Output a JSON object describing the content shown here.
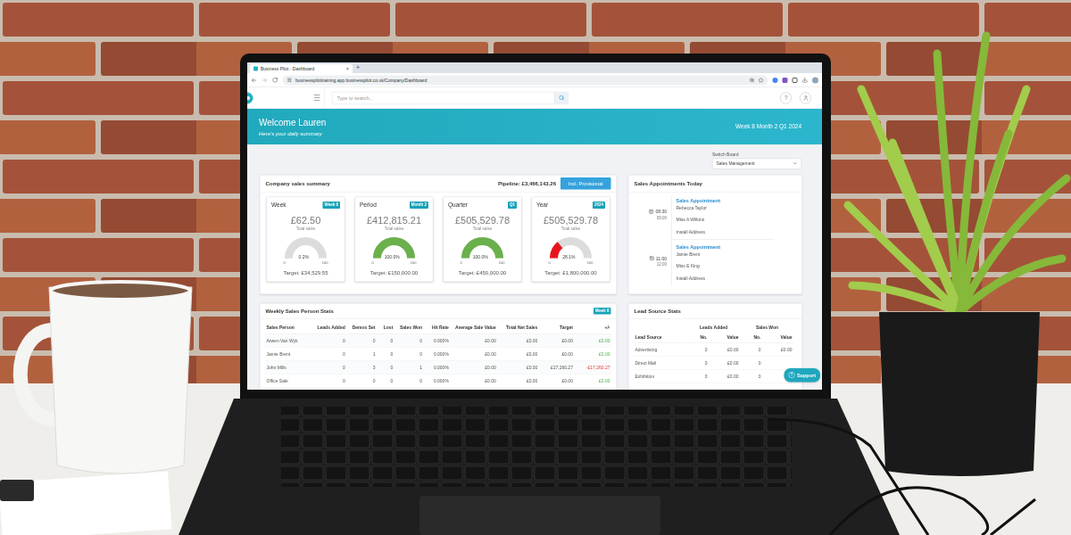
{
  "browser": {
    "tab_title": "Business Pilot - Dashboard",
    "close": "×",
    "new_tab": "+",
    "url": "businesspilottraining.app.businesspilot.co.uk/Company/Dashboard"
  },
  "app_header": {
    "menu": "☰",
    "search_placeholder": "Type to search...",
    "help": "?"
  },
  "banner": {
    "title": "Welcome Lauren",
    "subtitle": "Here's your daily summary",
    "period": "Week 8 Month 2 Q1 2024"
  },
  "switch_board": {
    "label": "Switch Board",
    "value": "Sales Management"
  },
  "sales_summary": {
    "title": "Company sales summary",
    "pipeline": "Pipeline: £3,466,143.26",
    "toggle": "Incl. Provisional",
    "cards": [
      {
        "title": "Week",
        "badge": "Week 8",
        "value": "£62.50",
        "caption": "Total sales",
        "level": 0.002,
        "percent": "0.2%",
        "min": "0",
        "max": "100",
        "target": "Target: £34,529.55",
        "color": "#6ab04c"
      },
      {
        "title": "Period",
        "badge": "Month 2",
        "value": "£412,815.21",
        "caption": "Total sales",
        "level": 1,
        "percent": "100.0%",
        "min": "0",
        "max": "100",
        "target": "Target: £150,000.00",
        "color": "#6ab04c"
      },
      {
        "title": "Quarter",
        "badge": "Q1",
        "value": "£505,529.78",
        "caption": "Total sales",
        "level": 1,
        "percent": "100.0%",
        "min": "0",
        "max": "100",
        "target": "Target: £450,000.00",
        "color": "#6ab04c"
      },
      {
        "title": "Year",
        "badge": "2024",
        "value": "£505,529.78",
        "caption": "Total sales",
        "level": 0.281,
        "percent": "28.1%",
        "min": "0",
        "max": "100",
        "target": "Target: £1,800,000.00",
        "color": "#e8141b"
      }
    ]
  },
  "appointments": {
    "title": "Sales Appointments Today",
    "items": [
      {
        "start": "08:30",
        "end": "09:00",
        "type": "Sales Appointment",
        "rep": "Rebecca Taylor",
        "customer": "Miss A Wilkins",
        "address": "Install Address"
      },
      {
        "start": "11:00",
        "end": "12:00",
        "type": "Sales Appointment",
        "rep": "Jamie Brent",
        "customer": "Miss E King",
        "address": "Install Address"
      }
    ]
  },
  "sales_person_stats": {
    "title": "Weekly Sales Person Stats",
    "badge": "Week 8",
    "columns": [
      "Sales Person",
      "Leads Added",
      "Demos Set",
      "Lost",
      "Sales Won",
      "Hit Rate",
      "Average Sale Value",
      "Total Net Sales",
      "Target",
      "+/-"
    ],
    "rows": [
      {
        "cells": [
          "Arwen Van Wyk",
          "0",
          "0",
          "0",
          "0",
          "0.000%",
          "£0.00",
          "£0.00",
          "£0.00",
          "£0.00"
        ],
        "color": "#4caf50"
      },
      {
        "cells": [
          "Jamie Brent",
          "0",
          "1",
          "0",
          "0",
          "0.000%",
          "£0.00",
          "£0.00",
          "£0.00",
          "£0.00"
        ],
        "color": "#4caf50"
      },
      {
        "cells": [
          "John Mills",
          "0",
          "3",
          "0",
          "1",
          "0.000%",
          "£0.00",
          "£0.00",
          "£17,260.27",
          "-£17,260.27"
        ],
        "color": "#e53935"
      },
      {
        "cells": [
          "Office Sale",
          "0",
          "0",
          "0",
          "0",
          "0.000%",
          "£0.00",
          "£0.00",
          "£0.00",
          "£0.00"
        ],
        "color": "#4caf50"
      }
    ]
  },
  "lead_source_stats": {
    "title": "Lead Source Stats",
    "groups": [
      "Leads Added",
      "Sales Won"
    ],
    "columns": [
      "Lead Source",
      "No.",
      "Value",
      "No.",
      "Value"
    ],
    "rows": [
      [
        "Advertising",
        "0",
        "£0.00",
        "0",
        "£0.00"
      ],
      [
        "Direct Mail",
        "0",
        "£0.00",
        "0"
      ],
      [
        "Exhibition",
        "0",
        "£0.00",
        "0"
      ]
    ]
  },
  "support": {
    "label": "Support",
    "icon": "?"
  }
}
